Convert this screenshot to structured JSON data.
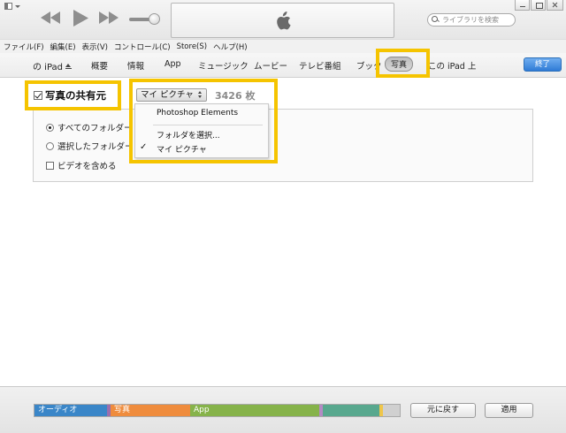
{
  "search": {
    "placeholder": "ライブラリを検索"
  },
  "menu": [
    "ファイル(F)",
    "編集(E)",
    "表示(V)",
    "コントロール(C)",
    "Store(S)",
    "ヘルプ(H)"
  ],
  "device_tabs": {
    "device": "の iPad",
    "items": [
      "概要",
      "情報",
      "App",
      "ミュージック",
      "ムービー",
      "テレビ番組",
      "ブック"
    ],
    "active": "写真",
    "on_device": "この iPad 上",
    "done": "終了"
  },
  "sync": {
    "label": "写真の共有元",
    "checked": true,
    "source": "マイ ピクチャ",
    "count": "3426 枚"
  },
  "dropdown": {
    "items": [
      "Photoshop Elements",
      "フォルダを選択...",
      "マイ ピクチャ"
    ],
    "checked_index": 2
  },
  "options": {
    "all_folders": "すべてのフォルダー",
    "selected_folders": "選択したフォルダー",
    "include_video": "ビデオを含める",
    "all_selected": true,
    "include_video_checked": false
  },
  "capacity": {
    "segments": [
      {
        "name": "オーディオ",
        "color": "#3a86c8"
      },
      {
        "name": "",
        "color": "#9b6fae"
      },
      {
        "name": "写真",
        "color": "#ef8c3d"
      },
      {
        "name": "App",
        "color": "#86b34a"
      },
      {
        "name": "",
        "color": "#b48bc4"
      },
      {
        "name": "",
        "color": "#58a88e"
      },
      {
        "name": "",
        "color": "#efc64a"
      },
      {
        "name": "",
        "color": "#d0d0d0"
      }
    ],
    "revert": "元に戻す",
    "apply": "適用"
  },
  "colors": {
    "highlight": "#f5c400",
    "accent_button": "#2f7bd6"
  }
}
